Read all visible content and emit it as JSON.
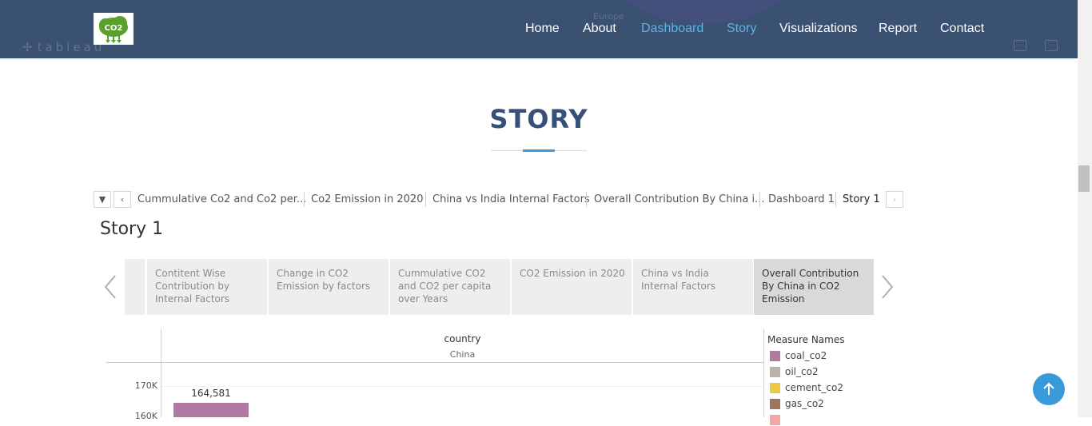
{
  "header": {
    "logo_text": "CO2",
    "ghost_text": [
      "Europe",
      "tableau"
    ],
    "nav": [
      {
        "label": "Home",
        "active": false
      },
      {
        "label": "About",
        "active": false
      },
      {
        "label": "Dashboard",
        "active": true
      },
      {
        "label": "Story",
        "active": true
      },
      {
        "label": "Visualizations",
        "active": false
      },
      {
        "label": "Report",
        "active": false
      },
      {
        "label": "Contact",
        "active": false
      }
    ]
  },
  "section": {
    "title": "STORY"
  },
  "tabs": {
    "menu_icon": "dropdown-arrow-icon",
    "items": [
      {
        "label": "Cummulative Co2 and Co2 per..."
      },
      {
        "label": "Co2 Emission in 2020"
      },
      {
        "label": "China vs India Internal Factors"
      },
      {
        "label": "Overall Contribution By China i..."
      },
      {
        "label": "Dashboard 1"
      },
      {
        "label": "Story 1",
        "current": true
      }
    ]
  },
  "story": {
    "heading": "Story 1",
    "points": [
      {
        "label": "Contitent Wise Contribution by Internal Factors"
      },
      {
        "label": "Change in CO2 Emission by factors"
      },
      {
        "label": "Cummulative CO2 and CO2 per capita over Years"
      },
      {
        "label": "CO2 Emission in 2020"
      },
      {
        "label": "China vs India Internal Factors"
      },
      {
        "label": "Overall Contribution By China in CO2 Emission",
        "selected": true
      }
    ]
  },
  "chart_data": {
    "type": "bar",
    "column_header": "country",
    "column_value": "China",
    "y_ticks": [
      "170K",
      "160K"
    ],
    "series": [
      {
        "name": "coal_co2",
        "values": [
          164581
        ]
      }
    ],
    "data_labels": [
      "164,581"
    ],
    "legend": {
      "title": "Measure Names",
      "items": [
        {
          "label": "coal_co2",
          "color": "#b07aa1"
        },
        {
          "label": "oil_co2",
          "color": "#bab0ac"
        },
        {
          "label": "cement_co2",
          "color": "#edc948"
        },
        {
          "label": "gas_co2",
          "color": "#9c755f"
        }
      ]
    }
  },
  "colors": {
    "header_bg": "#3a5172",
    "accent": "#3a9ad9",
    "nav_active": "#5db2e6",
    "title": "#36507a"
  }
}
